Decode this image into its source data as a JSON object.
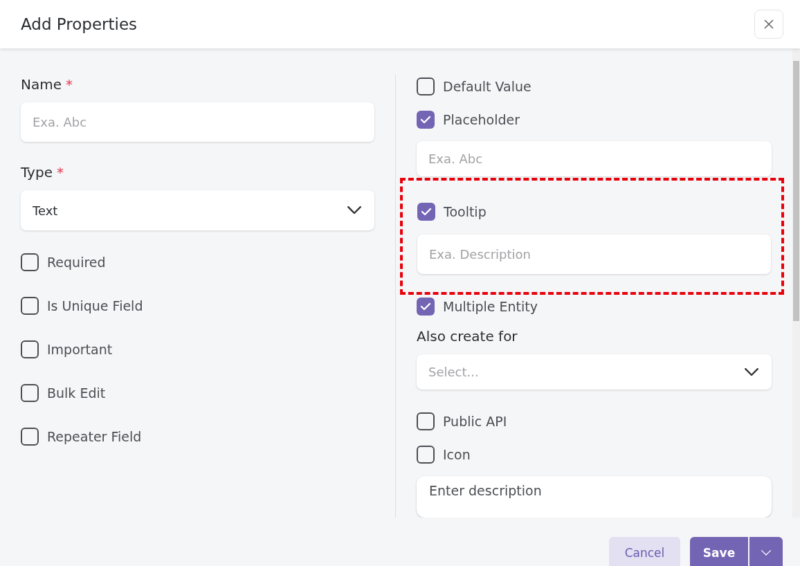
{
  "dialog": {
    "title": "Add Properties"
  },
  "left": [
    {
      "kind": "label",
      "text": "Name",
      "mark": "*"
    },
    {
      "kind": "input",
      "placeholder": "Exa. Abc"
    },
    {
      "kind": "label",
      "text": "Type",
      "mark": "*"
    },
    {
      "kind": "select",
      "value": "Text"
    },
    {
      "kind": "checkbox",
      "label": "Required",
      "checked": false
    },
    {
      "kind": "checkbox",
      "label": "Is Unique Field",
      "checked": false
    },
    {
      "kind": "checkbox",
      "label": "Important",
      "checked": false
    },
    {
      "kind": "checkbox",
      "label": "Bulk Edit",
      "checked": false
    },
    {
      "kind": "checkbox",
      "label": "Repeater Field",
      "checked": false
    }
  ],
  "right": [
    {
      "kind": "checkbox",
      "label": "Default Value",
      "checked": false
    },
    {
      "kind": "checkbox",
      "label": "Placeholder",
      "checked": true
    },
    {
      "kind": "input",
      "placeholder": "Exa. Abc"
    },
    {
      "kind": "group",
      "highlighted": true,
      "items": [
        {
          "kind": "checkbox",
          "label": "Tooltip",
          "checked": true
        },
        {
          "kind": "input",
          "placeholder": "Exa. Description"
        }
      ]
    },
    {
      "kind": "checkbox",
      "label": "Multiple Entity",
      "checked": true
    },
    {
      "kind": "label",
      "text": "Also create for"
    },
    {
      "kind": "select",
      "placeholder": "Select..."
    },
    {
      "kind": "checkbox",
      "label": "Public API",
      "checked": false
    },
    {
      "kind": "checkbox",
      "label": "Icon",
      "checked": false
    },
    {
      "kind": "textarea",
      "value": "Enter description"
    }
  ],
  "footer": {
    "cancel": "Cancel",
    "save": "Save"
  }
}
